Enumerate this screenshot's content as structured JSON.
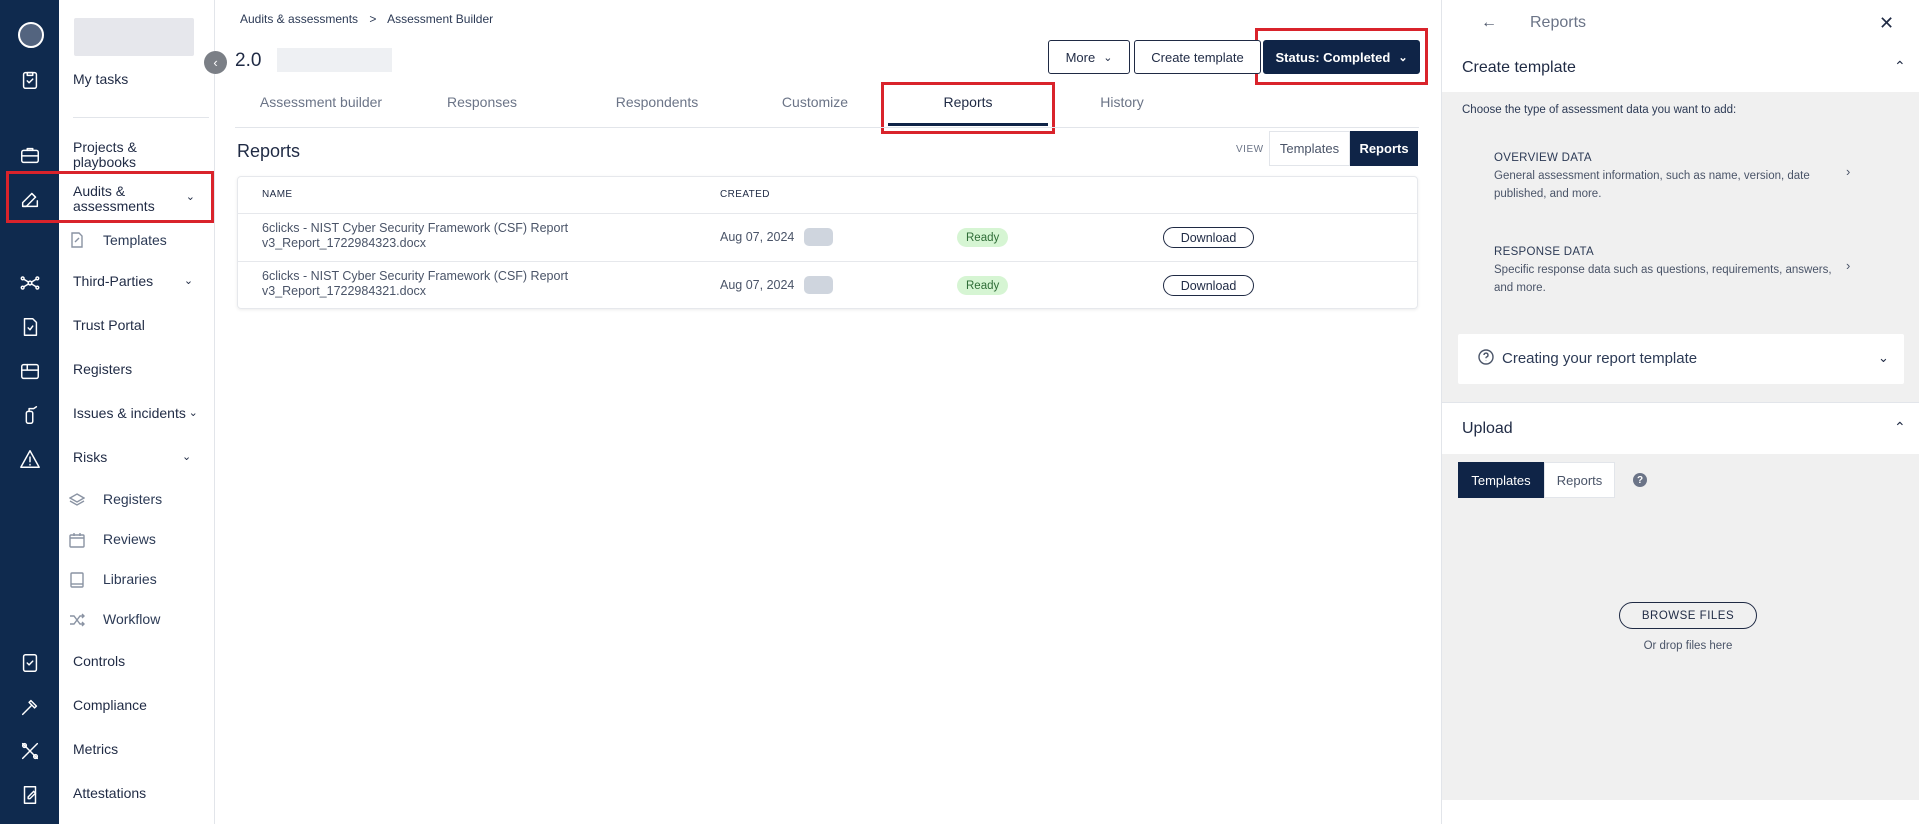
{
  "sidebar": {
    "items": [
      {
        "label": "My tasks"
      },
      {
        "label": "Projects & playbooks"
      },
      {
        "label": "Audits & assessments"
      },
      {
        "label": "Templates"
      },
      {
        "label": "Third-Parties"
      },
      {
        "label": "Trust Portal"
      },
      {
        "label": "Registers"
      },
      {
        "label": "Issues & incidents"
      },
      {
        "label": "Risks"
      },
      {
        "label": "Registers"
      },
      {
        "label": "Reviews"
      },
      {
        "label": "Libraries"
      },
      {
        "label": "Workflow"
      },
      {
        "label": "Controls"
      },
      {
        "label": "Compliance"
      },
      {
        "label": "Metrics"
      },
      {
        "label": "Attestations"
      }
    ]
  },
  "breadcrumb": {
    "parent": "Audits & assessments",
    "separator": ">",
    "current": "Assessment Builder"
  },
  "header": {
    "version": "2.0",
    "more_label": "More",
    "create_template_label": "Create template",
    "status_label": "Status: Completed"
  },
  "tabs": [
    {
      "label": "Assessment builder"
    },
    {
      "label": "Responses"
    },
    {
      "label": "Respondents"
    },
    {
      "label": "Customize"
    },
    {
      "label": "Reports"
    },
    {
      "label": "History"
    }
  ],
  "reports": {
    "title": "Reports",
    "view_label": "VIEW",
    "view_options": [
      "Templates",
      "Reports"
    ],
    "view_selected": "Reports",
    "columns": [
      "NAME",
      "CREATED"
    ],
    "rows": [
      {
        "name_line1": "6clicks - NIST Cyber Security Framework (CSF) Report",
        "name_line2": "v3_Report_1722984323.docx",
        "created": "Aug 07, 2024",
        "status": "Ready",
        "action": "Download"
      },
      {
        "name_line1": "6clicks - NIST Cyber Security Framework (CSF) Report",
        "name_line2": "v3_Report_1722984321.docx",
        "created": "Aug 07, 2024",
        "status": "Ready",
        "action": "Download"
      }
    ]
  },
  "panel": {
    "title": "Reports",
    "create_template_title": "Create template",
    "choose_text": "Choose the type of assessment data you want to add:",
    "options": [
      {
        "heading": "OVERVIEW DATA",
        "line1": "General assessment information, such as name, version, date",
        "line2": "published, and more."
      },
      {
        "heading": "RESPONSE DATA",
        "line1": "Specific response data such as questions, requirements, answers,",
        "line2": "and more."
      }
    ],
    "accordion_title": "Creating your report template",
    "upload_title": "Upload",
    "upload_tabs": [
      "Templates",
      "Reports"
    ],
    "upload_selected": "Templates",
    "browse_label": "BROWSE FILES",
    "drop_text": "Or drop files here"
  },
  "colors": {
    "navy": "#0f2447",
    "highlight": "#d9232b",
    "ready_bg": "#d6f5d3"
  }
}
